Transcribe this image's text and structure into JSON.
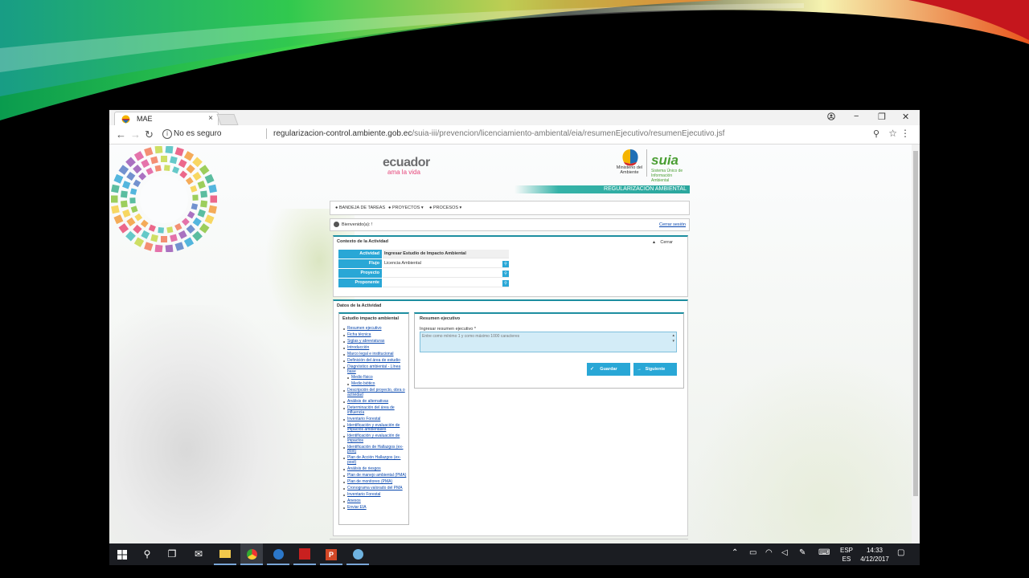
{
  "browser": {
    "tab_title": "MAE",
    "tab_close": "×",
    "not_secure": "No es seguro",
    "url_host": "regularizacion-control.ambiente.gob.ec",
    "url_path": "/suia-iii/prevencion/licenciamiento-ambiental/eia/resumenEjecutivo/resumenEjecutivo.jsf",
    "back": "←",
    "forward": "→",
    "reload": "↻",
    "minimize": "−",
    "restore": "❐",
    "close": "✕",
    "zoom_icon": "⚲",
    "star_icon": "☆",
    "menu_icon": "⋮"
  },
  "header": {
    "ecuador": "ecuador",
    "ama_la_vida": "ama la vida",
    "ministerio": "Ministerio del Ambiente",
    "suia": "suia",
    "suia_sub": "Sistema Único de Información Ambiental",
    "banner": "REGULARIZACIÓN AMBIENTAL"
  },
  "menu": {
    "items": [
      "BANDEJA DE TAREAS",
      "PROYECTOS ▾",
      "PROCESOS ▾"
    ]
  },
  "welcome": {
    "text": "Bienvenido(a): !",
    "logout": "Cerrar sesión"
  },
  "context": {
    "title": "Contexto de la Actividad",
    "close": "Cerrar",
    "collapse": "▴",
    "rows": [
      {
        "label": "Actividad",
        "value": "Ingresar Estudio de Impacto Ambiental"
      },
      {
        "label": "Flujo",
        "value": "Licencia Ambiental"
      },
      {
        "label": "Proyecto",
        "value": ""
      },
      {
        "label": "Proponente",
        "value": ""
      }
    ]
  },
  "datos": {
    "title": "Datos de la Actividad",
    "nav_title": "Estudio impacto ambiental",
    "nav_items": [
      {
        "label": "Resumen ejecutivo",
        "sub": false
      },
      {
        "label": "Ficha técnica",
        "sub": false
      },
      {
        "label": "Siglas y abreviaturas",
        "sub": false
      },
      {
        "label": "Introducción",
        "sub": false
      },
      {
        "label": "Marco legal e institucional",
        "sub": false
      },
      {
        "label": "Definición del área de estudio",
        "sub": false
      },
      {
        "label": "Diagnóstico ambiental - Línea base",
        "sub": false
      },
      {
        "label": "Medio físico",
        "sub": true
      },
      {
        "label": "Medio biótico",
        "sub": true
      },
      {
        "label": "Descripción del proyecto, obra o actividad",
        "sub": false
      },
      {
        "label": "Análisis de alternativas",
        "sub": false
      },
      {
        "label": "Determinación del área de influencia",
        "sub": false
      },
      {
        "label": "Inventario Forestal",
        "sub": false
      },
      {
        "label": "Identificación y evaluación de impactos ambientales",
        "sub": false
      },
      {
        "label": "Identificación y evaluación de impactos",
        "sub": false
      },
      {
        "label": "Identificación de Hallazgos (ex-post)",
        "sub": false
      },
      {
        "label": "Plan de Acción Hallazgos (ex-post)",
        "sub": false
      },
      {
        "label": "Análisis de riesgos",
        "sub": false
      },
      {
        "label": "Plan de manejo ambiental (PMA)",
        "sub": false
      },
      {
        "label": "Plan de monitoreo (PMA)",
        "sub": false
      },
      {
        "label": "Cronograma valorado del PMA",
        "sub": false
      },
      {
        "label": "Inventario Forestal",
        "sub": false
      },
      {
        "label": "Anexos",
        "sub": false
      },
      {
        "label": "Enviar EIA",
        "sub": false
      }
    ]
  },
  "resumen": {
    "title": "Resumen ejecutivo",
    "field_label": "Ingresar resumen ejecutivo *",
    "placeholder": "Entre como mínimo 1 y como máximo 1000 caracteres",
    "save_label": "Guardar",
    "next_label": "Siguiente",
    "save_icon": "✓",
    "next_icon": "→"
  },
  "taskbar": {
    "lang_top": "ESP",
    "lang_bottom": "ES",
    "time": "14:33",
    "date": "4/12/2017"
  },
  "colors": {
    "accent": "#29a7d6",
    "teal": "#1d8ea0",
    "banner": "#35b3a8",
    "suia_green": "#4a9e32"
  }
}
